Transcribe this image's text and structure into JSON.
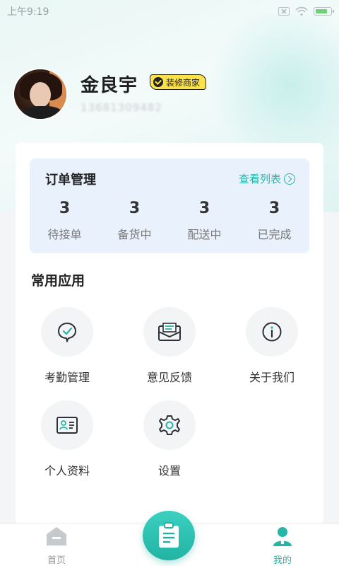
{
  "status_bar": {
    "time": "上午9:19"
  },
  "profile": {
    "name": "金良宇",
    "badge": "装修商家",
    "phone": "13681309482"
  },
  "orders": {
    "title": "订单管理",
    "view_list": "查看列表",
    "stats": [
      {
        "count": "3",
        "label": "待接单"
      },
      {
        "count": "3",
        "label": "备货中"
      },
      {
        "count": "3",
        "label": "配送中"
      },
      {
        "count": "3",
        "label": "已完成"
      }
    ]
  },
  "apps": {
    "title": "常用应用",
    "items": [
      {
        "label": "考勤管理",
        "icon": "attendance-icon"
      },
      {
        "label": "意见反馈",
        "icon": "feedback-icon"
      },
      {
        "label": "关于我们",
        "icon": "info-icon"
      },
      {
        "label": "个人资料",
        "icon": "profile-card-icon"
      },
      {
        "label": "设置",
        "icon": "gear-icon"
      }
    ]
  },
  "bottom_nav": {
    "home": "首页",
    "mine": "我的"
  },
  "colors": {
    "accent": "#27b5a6",
    "badge_bg": "#fbe24a",
    "order_bg": "#e8f1fc",
    "inactive_nav": "#999999"
  }
}
